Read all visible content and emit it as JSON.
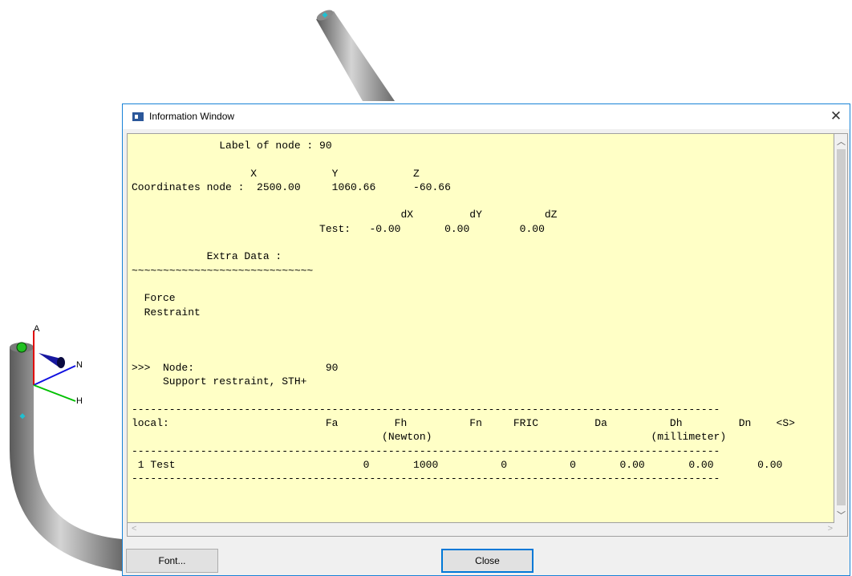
{
  "window": {
    "title": "Information Window",
    "close_glyph": "✕",
    "report_lines": [
      "              Label of node : 90",
      "",
      "                   X            Y            Z",
      "Coordinates node :  2500.00     1060.66      -60.66",
      "",
      "                                           dX         dY          dZ",
      "                              Test:   -0.00       0.00        0.00",
      "",
      "            Extra Data :",
      "~~~~~~~~~~~~~~~~~~~~~~~~~~~~~",
      "",
      "  Force",
      "  Restraint",
      "",
      "",
      "",
      ">>>  Node:                     90",
      "     Support restraint, STH+",
      "",
      "----------------------------------------------------------------------------------------------",
      "local:                         Fa         Fh          Fn     FRIC         Da          Dh         Dn    <S>",
      "                                        (Newton)                                   (millimeter)",
      "----------------------------------------------------------------------------------------------",
      " 1 Test                              0       1000          0          0       0.00       0.00       0.00",
      "----------------------------------------------------------------------------------------------"
    ],
    "font_button": "Font...",
    "close_button": "Close"
  },
  "scene": {
    "axis_labels": {
      "a": "A",
      "n": "N",
      "h": "H"
    },
    "colors": {
      "axis_a": "#e00000",
      "axis_n": "#1010e0",
      "axis_h": "#00c000",
      "pipe": "#888888"
    }
  }
}
